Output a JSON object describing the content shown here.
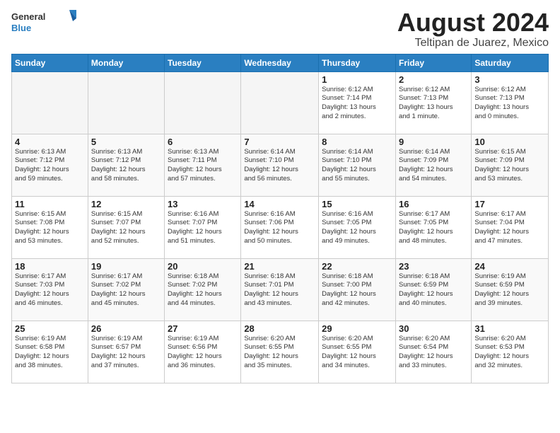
{
  "header": {
    "logo_general": "General",
    "logo_blue": "Blue",
    "month_year": "August 2024",
    "location": "Teltipan de Juarez, Mexico"
  },
  "weekdays": [
    "Sunday",
    "Monday",
    "Tuesday",
    "Wednesday",
    "Thursday",
    "Friday",
    "Saturday"
  ],
  "weeks": [
    [
      {
        "day": "",
        "info": ""
      },
      {
        "day": "",
        "info": ""
      },
      {
        "day": "",
        "info": ""
      },
      {
        "day": "",
        "info": ""
      },
      {
        "day": "1",
        "info": "Sunrise: 6:12 AM\nSunset: 7:14 PM\nDaylight: 13 hours\nand 2 minutes."
      },
      {
        "day": "2",
        "info": "Sunrise: 6:12 AM\nSunset: 7:13 PM\nDaylight: 13 hours\nand 1 minute."
      },
      {
        "day": "3",
        "info": "Sunrise: 6:12 AM\nSunset: 7:13 PM\nDaylight: 13 hours\nand 0 minutes."
      }
    ],
    [
      {
        "day": "4",
        "info": "Sunrise: 6:13 AM\nSunset: 7:12 PM\nDaylight: 12 hours\nand 59 minutes."
      },
      {
        "day": "5",
        "info": "Sunrise: 6:13 AM\nSunset: 7:12 PM\nDaylight: 12 hours\nand 58 minutes."
      },
      {
        "day": "6",
        "info": "Sunrise: 6:13 AM\nSunset: 7:11 PM\nDaylight: 12 hours\nand 57 minutes."
      },
      {
        "day": "7",
        "info": "Sunrise: 6:14 AM\nSunset: 7:10 PM\nDaylight: 12 hours\nand 56 minutes."
      },
      {
        "day": "8",
        "info": "Sunrise: 6:14 AM\nSunset: 7:10 PM\nDaylight: 12 hours\nand 55 minutes."
      },
      {
        "day": "9",
        "info": "Sunrise: 6:14 AM\nSunset: 7:09 PM\nDaylight: 12 hours\nand 54 minutes."
      },
      {
        "day": "10",
        "info": "Sunrise: 6:15 AM\nSunset: 7:09 PM\nDaylight: 12 hours\nand 53 minutes."
      }
    ],
    [
      {
        "day": "11",
        "info": "Sunrise: 6:15 AM\nSunset: 7:08 PM\nDaylight: 12 hours\nand 53 minutes."
      },
      {
        "day": "12",
        "info": "Sunrise: 6:15 AM\nSunset: 7:07 PM\nDaylight: 12 hours\nand 52 minutes."
      },
      {
        "day": "13",
        "info": "Sunrise: 6:16 AM\nSunset: 7:07 PM\nDaylight: 12 hours\nand 51 minutes."
      },
      {
        "day": "14",
        "info": "Sunrise: 6:16 AM\nSunset: 7:06 PM\nDaylight: 12 hours\nand 50 minutes."
      },
      {
        "day": "15",
        "info": "Sunrise: 6:16 AM\nSunset: 7:05 PM\nDaylight: 12 hours\nand 49 minutes."
      },
      {
        "day": "16",
        "info": "Sunrise: 6:17 AM\nSunset: 7:05 PM\nDaylight: 12 hours\nand 48 minutes."
      },
      {
        "day": "17",
        "info": "Sunrise: 6:17 AM\nSunset: 7:04 PM\nDaylight: 12 hours\nand 47 minutes."
      }
    ],
    [
      {
        "day": "18",
        "info": "Sunrise: 6:17 AM\nSunset: 7:03 PM\nDaylight: 12 hours\nand 46 minutes."
      },
      {
        "day": "19",
        "info": "Sunrise: 6:17 AM\nSunset: 7:02 PM\nDaylight: 12 hours\nand 45 minutes."
      },
      {
        "day": "20",
        "info": "Sunrise: 6:18 AM\nSunset: 7:02 PM\nDaylight: 12 hours\nand 44 minutes."
      },
      {
        "day": "21",
        "info": "Sunrise: 6:18 AM\nSunset: 7:01 PM\nDaylight: 12 hours\nand 43 minutes."
      },
      {
        "day": "22",
        "info": "Sunrise: 6:18 AM\nSunset: 7:00 PM\nDaylight: 12 hours\nand 42 minutes."
      },
      {
        "day": "23",
        "info": "Sunrise: 6:18 AM\nSunset: 6:59 PM\nDaylight: 12 hours\nand 40 minutes."
      },
      {
        "day": "24",
        "info": "Sunrise: 6:19 AM\nSunset: 6:59 PM\nDaylight: 12 hours\nand 39 minutes."
      }
    ],
    [
      {
        "day": "25",
        "info": "Sunrise: 6:19 AM\nSunset: 6:58 PM\nDaylight: 12 hours\nand 38 minutes."
      },
      {
        "day": "26",
        "info": "Sunrise: 6:19 AM\nSunset: 6:57 PM\nDaylight: 12 hours\nand 37 minutes."
      },
      {
        "day": "27",
        "info": "Sunrise: 6:19 AM\nSunset: 6:56 PM\nDaylight: 12 hours\nand 36 minutes."
      },
      {
        "day": "28",
        "info": "Sunrise: 6:20 AM\nSunset: 6:55 PM\nDaylight: 12 hours\nand 35 minutes."
      },
      {
        "day": "29",
        "info": "Sunrise: 6:20 AM\nSunset: 6:55 PM\nDaylight: 12 hours\nand 34 minutes."
      },
      {
        "day": "30",
        "info": "Sunrise: 6:20 AM\nSunset: 6:54 PM\nDaylight: 12 hours\nand 33 minutes."
      },
      {
        "day": "31",
        "info": "Sunrise: 6:20 AM\nSunset: 6:53 PM\nDaylight: 12 hours\nand 32 minutes."
      }
    ]
  ]
}
